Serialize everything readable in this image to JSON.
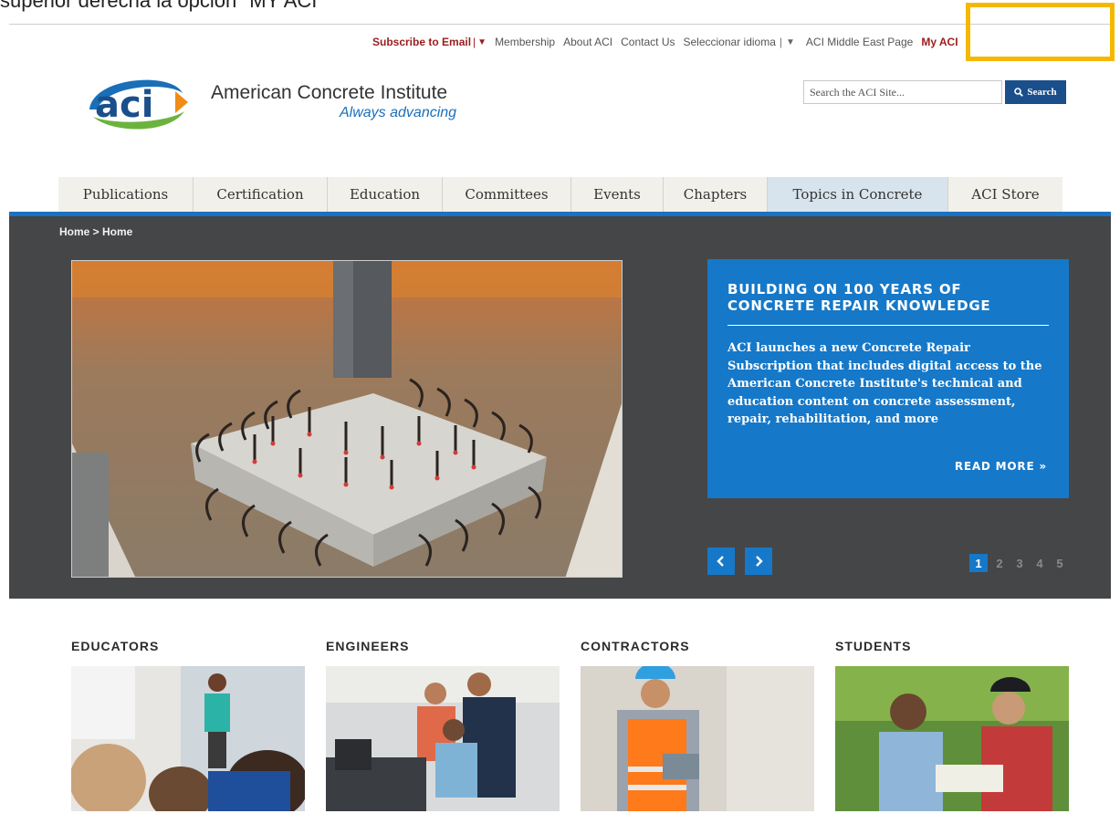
{
  "caption": "superior derecha la opción \"MY ACI\"",
  "utility_bar": {
    "subscribe": "Subscribe to Email",
    "subscribe_arrow": "▼",
    "membership": "Membership",
    "about": "About ACI",
    "contact": "Contact Us",
    "language": "Seleccionar idioma",
    "language_sep": "|",
    "language_arrow": "▼",
    "middle_east": "ACI Middle East Page",
    "my_aci": "My ACI"
  },
  "logo": {
    "mark": "aci",
    "name": "American Concrete Institute",
    "tagline": "Always advancing"
  },
  "search": {
    "placeholder": "Search the ACI Site...",
    "button": "Search"
  },
  "nav": [
    {
      "label": "Publications",
      "active": false
    },
    {
      "label": "Certification",
      "active": false
    },
    {
      "label": "Education",
      "active": false
    },
    {
      "label": "Committees",
      "active": false
    },
    {
      "label": "Events",
      "active": false
    },
    {
      "label": "Chapters",
      "active": false
    },
    {
      "label": "Topics in Concrete",
      "active": true
    },
    {
      "label": "ACI Store",
      "active": false
    }
  ],
  "breadcrumb": "Home > Home",
  "hero": {
    "title": "BUILDING ON 100 YEARS OF CONCRETE REPAIR KNOWLEDGE",
    "body": "ACI launches a new Concrete Repair Subscription that includes digital access to the American Concrete Institute's technical and education content on concrete assessment, repair, rehabilitation, and more",
    "read_more": "READ MORE »",
    "prev": "‹",
    "next": "›",
    "pages": [
      "1",
      "2",
      "3",
      "4",
      "5"
    ],
    "current_page": "1"
  },
  "audiences": [
    {
      "label": "EDUCATORS"
    },
    {
      "label": "ENGINEERS"
    },
    {
      "label": "CONTRACTORS"
    },
    {
      "label": "STUDENTS"
    }
  ],
  "colors": {
    "brand_red": "#9b1c1c",
    "brand_blue": "#1678c8",
    "nav_active": "#d8e4ed",
    "hero_bg": "#454648",
    "highlight": "#f5b800"
  }
}
